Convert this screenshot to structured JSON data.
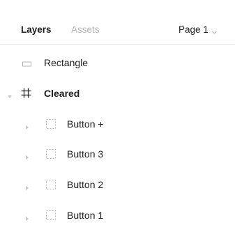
{
  "header": {
    "tabs": [
      {
        "label": "Layers",
        "active": true
      },
      {
        "label": "Assets",
        "active": false
      }
    ],
    "page_selector": {
      "label": "Page 1",
      "icon": "chevron-down-icon"
    }
  },
  "layers": [
    {
      "label": "Rectangle",
      "icon": "rectangle-icon",
      "expandable": false,
      "bold": false
    },
    {
      "label": "Cleared",
      "icon": "frame-icon",
      "expandable": true,
      "expanded": true,
      "bold": true
    },
    {
      "label": "Button +",
      "icon": "group-dashed-icon",
      "expandable": true,
      "expanded": false,
      "bold": false
    },
    {
      "label": "Button 3",
      "icon": "group-dashed-icon",
      "expandable": true,
      "expanded": false,
      "bold": false
    },
    {
      "label": "Button 2",
      "icon": "group-dashed-icon",
      "expandable": true,
      "expanded": false,
      "bold": false
    },
    {
      "label": "Button 1",
      "icon": "group-dashed-icon",
      "expandable": true,
      "expanded": false,
      "bold": false
    }
  ],
  "colors": {
    "text": "#1e1e1e",
    "muted": "#b3b3b3",
    "divider": "#e6e6e6",
    "icon": "#b3b3b3"
  }
}
